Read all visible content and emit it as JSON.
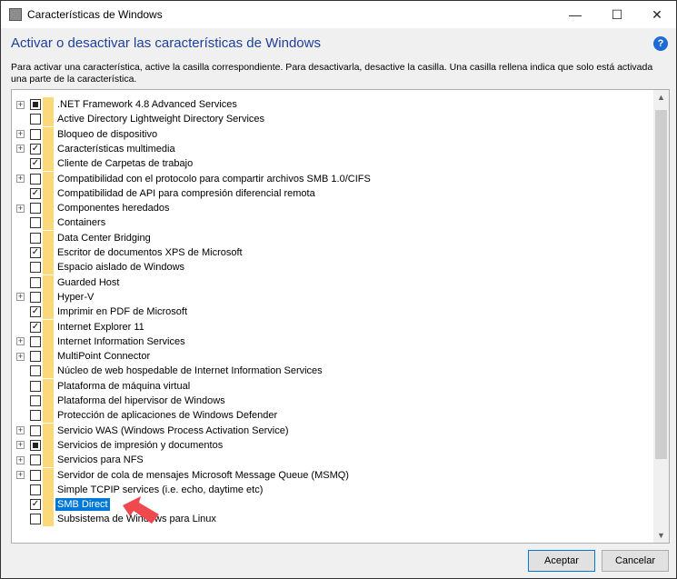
{
  "window": {
    "title": "Características de Windows",
    "minimize": "—",
    "maximize": "☐",
    "close": "✕"
  },
  "heading": "Activar o desactivar las características de Windows",
  "help": "?",
  "description": "Para activar una característica, active la casilla correspondiente. Para desactivarla, desactive la casilla. Una casilla rellena indica que solo está activada una parte de la característica.",
  "features": [
    {
      "label": ".NET Framework 4.8 Advanced Services",
      "expandable": true,
      "state": "partial"
    },
    {
      "label": "Active Directory Lightweight Directory Services",
      "expandable": false,
      "state": "unchecked"
    },
    {
      "label": "Bloqueo de dispositivo",
      "expandable": true,
      "state": "unchecked"
    },
    {
      "label": "Características multimedia",
      "expandable": true,
      "state": "checked"
    },
    {
      "label": "Cliente de Carpetas de trabajo",
      "expandable": false,
      "state": "checked"
    },
    {
      "label": "Compatibilidad con el protocolo para compartir archivos SMB 1.0/CIFS",
      "expandable": true,
      "state": "unchecked"
    },
    {
      "label": "Compatibilidad de API para compresión diferencial remota",
      "expandable": false,
      "state": "checked"
    },
    {
      "label": "Componentes heredados",
      "expandable": true,
      "state": "unchecked"
    },
    {
      "label": "Containers",
      "expandable": false,
      "state": "unchecked"
    },
    {
      "label": "Data Center Bridging",
      "expandable": false,
      "state": "unchecked"
    },
    {
      "label": "Escritor de documentos XPS de Microsoft",
      "expandable": false,
      "state": "checked"
    },
    {
      "label": "Espacio aislado de Windows",
      "expandable": false,
      "state": "unchecked"
    },
    {
      "label": "Guarded Host",
      "expandable": false,
      "state": "unchecked"
    },
    {
      "label": "Hyper-V",
      "expandable": true,
      "state": "unchecked"
    },
    {
      "label": "Imprimir en PDF de Microsoft",
      "expandable": false,
      "state": "checked"
    },
    {
      "label": "Internet Explorer 11",
      "expandable": false,
      "state": "checked"
    },
    {
      "label": "Internet Information Services",
      "expandable": true,
      "state": "unchecked"
    },
    {
      "label": "MultiPoint Connector",
      "expandable": true,
      "state": "unchecked"
    },
    {
      "label": "Núcleo de web hospedable de Internet Information Services",
      "expandable": false,
      "state": "unchecked"
    },
    {
      "label": "Plataforma de máquina virtual",
      "expandable": false,
      "state": "unchecked"
    },
    {
      "label": "Plataforma del hipervisor de Windows",
      "expandable": false,
      "state": "unchecked"
    },
    {
      "label": "Protección de aplicaciones de Windows Defender",
      "expandable": false,
      "state": "unchecked"
    },
    {
      "label": "Servicio WAS (Windows Process Activation Service)",
      "expandable": true,
      "state": "unchecked"
    },
    {
      "label": "Servicios de impresión y documentos",
      "expandable": true,
      "state": "partial"
    },
    {
      "label": "Servicios para NFS",
      "expandable": true,
      "state": "unchecked"
    },
    {
      "label": "Servidor de cola de mensajes Microsoft Message Queue (MSMQ)",
      "expandable": true,
      "state": "unchecked"
    },
    {
      "label": "Simple TCPIP services (i.e. echo, daytime etc)",
      "expandable": false,
      "state": "unchecked"
    },
    {
      "label": "SMB Direct",
      "expandable": false,
      "state": "checked",
      "selected": true
    },
    {
      "label": "Subsistema de Windows para Linux",
      "expandable": false,
      "state": "unchecked"
    }
  ],
  "buttons": {
    "ok": "Aceptar",
    "cancel": "Cancelar"
  },
  "colors": {
    "accent": "#0078d7",
    "heading": "#1e3f9a",
    "folder": "#fbd979",
    "arrow": "#f0484f"
  }
}
